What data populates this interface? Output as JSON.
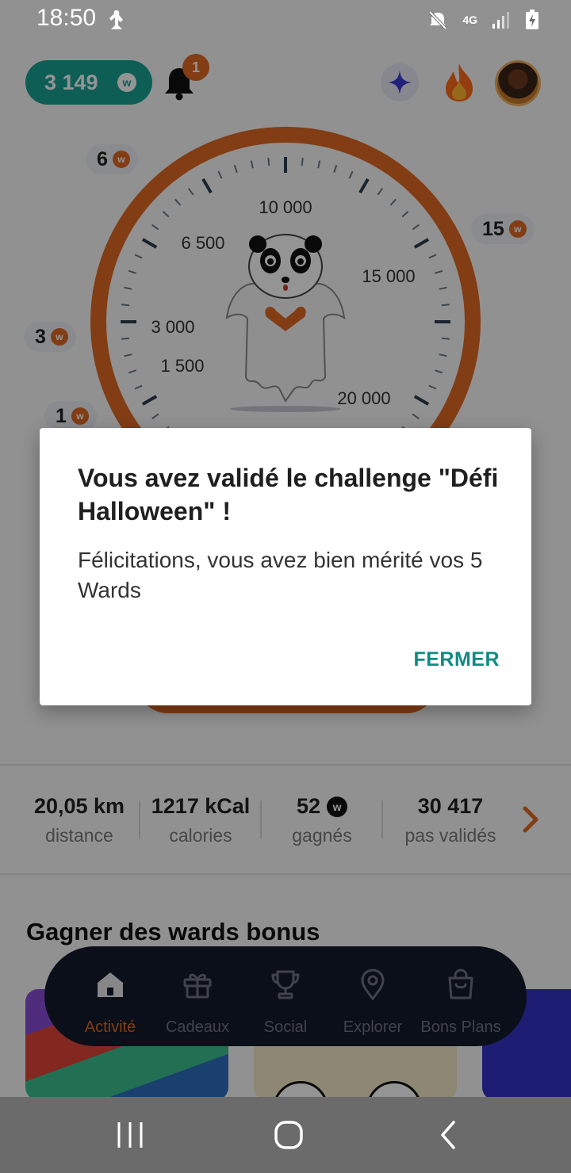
{
  "status_bar": {
    "time": "18:50",
    "network": "4G"
  },
  "header": {
    "wards_balance": "3 149",
    "ward_coin_symbol": "w",
    "notification_count": "1"
  },
  "gauge": {
    "scale_labels": [
      "10 000",
      "6 500",
      "15 000",
      "3 000",
      "1 500",
      "20 000"
    ],
    "bonus_levels": [
      {
        "value": "6"
      },
      {
        "value": "15"
      },
      {
        "value": "3"
      },
      {
        "value": "1"
      }
    ],
    "accent_color": "#e06a25"
  },
  "stats": [
    {
      "value": "20,05 km",
      "label": "distance"
    },
    {
      "value": "1217 kCal",
      "label": "calories"
    },
    {
      "value": "52",
      "label": "gagnés"
    },
    {
      "value": "30 417",
      "label": "pas validés"
    }
  ],
  "section": {
    "title": "Gagner des wards bonus"
  },
  "bottom_nav": {
    "items": [
      {
        "label": "Activité",
        "icon": "home-icon",
        "active": true
      },
      {
        "label": "Cadeaux",
        "icon": "gift-icon",
        "active": false
      },
      {
        "label": "Social",
        "icon": "trophy-icon",
        "active": false
      },
      {
        "label": "Explorer",
        "icon": "map-pin-icon",
        "active": false
      },
      {
        "label": "Bons Plans",
        "icon": "shopping-bag-icon",
        "active": false
      }
    ]
  },
  "dialog": {
    "title": "Vous avez validé le challenge \"Défi Halloween\" !",
    "message": "Félicitations, vous avez bien mérité vos 5 Wards",
    "close_label": "FERMER"
  },
  "colors": {
    "teal": "#1aa395",
    "orange": "#e06a25",
    "nav_dark": "#141a2b",
    "dialog_button": "#108b84"
  }
}
